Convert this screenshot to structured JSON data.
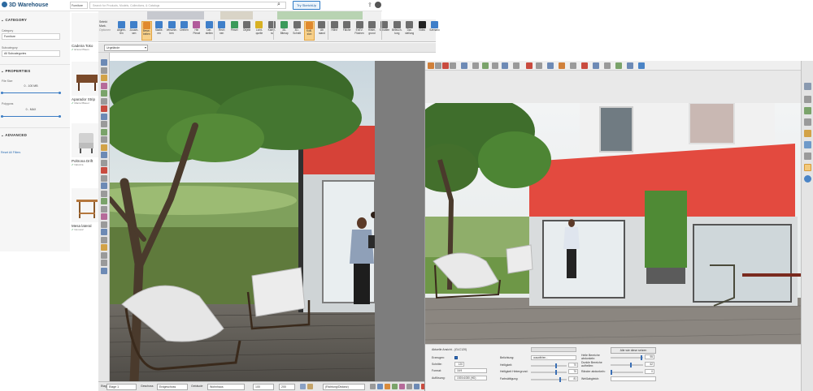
{
  "warehouse": {
    "logo": "3D Warehouse",
    "category_select": "Furniture",
    "search_placeholder": "Search for Products, Models, Collections, & Catalogs",
    "try_button": "Try SketchUp",
    "filter": {
      "category_heading": "CATEGORY",
      "category_label": "Category",
      "category_value": "Furniture",
      "subcategory_label": "Subcategory",
      "subcategory_value": "All Subcategories",
      "properties_heading": "PROPERTIES",
      "file_size_label": "File Size",
      "file_size_range": "0 - 100 MB",
      "file_size_fill": 1.0,
      "polygons_label": "Polygons",
      "polygons_range": "0 - MAX",
      "polygons_fill": 1.0,
      "advanced_heading": "ADVANCED",
      "reset_link": "Reset All Filters"
    },
    "results": [
      {
        "name": "Cadeira Toko",
        "author": "El'ana Pflaum"
      },
      {
        "name": "Aparador Strip",
        "author": "Marcel Bleuel"
      },
      {
        "name": "Poltrona Drift",
        "author": "Natuzza"
      },
      {
        "name": "Mesa lateral",
        "author": "Nomon2"
      }
    ]
  },
  "toolbar": {
    "select_block": [
      "Selekt",
      "Mark.",
      "Optionen"
    ],
    "buttons": [
      {
        "label": "Abgren-\nfen",
        "active": false,
        "color": "#3f7fc9"
      },
      {
        "label": "Zusam-\nsen",
        "active": false,
        "color": "#3f7fc9"
      },
      {
        "label": "Bewe-\nbeiten",
        "active": true,
        "color": "#e0892e"
      },
      {
        "label": "Skalie-\nren",
        "active": false,
        "color": "#3f7fc9"
      },
      {
        "label": "Verschie-\nben",
        "active": false,
        "color": "#3f7fc9"
      },
      {
        "label": "Drehen",
        "active": false,
        "color": "#3f7fc9"
      },
      {
        "label": "Hin\nPinsel",
        "active": false,
        "color": "#b15a9b"
      },
      {
        "label": "Dar-\nstellen",
        "active": false,
        "color": "#3f7fc9"
      },
      {
        "label": "Rech\nnen",
        "active": false,
        "color": "#3f7fc9"
      },
      {
        "label": "Pinsel",
        "active": false,
        "color": "#3b9a5a"
      },
      {
        "label": "Objekt",
        "active": false,
        "color": "#6d6d6d"
      },
      {
        "label": "Licht-\nquelle",
        "active": false,
        "color": "#d8b123"
      },
      {
        "label": "Kame-\nra",
        "active": false,
        "color": "#6d6d6d"
      },
      {
        "label": "3D-\nBitmap",
        "active": false,
        "color": "#3b9a5a"
      },
      {
        "label": "3D-\nSchnitt",
        "active": false,
        "color": "#6d6d6d"
      },
      {
        "label": "Kolli-\nsion",
        "active": true,
        "color": "#e0892e"
      },
      {
        "label": "Ab\nstand",
        "active": false,
        "color": "#6d6d6d"
      },
      {
        "label": "Höhe",
        "active": false,
        "color": "#6d6d6d"
      },
      {
        "label": "Fläche",
        "active": false,
        "color": "#6d6d6d"
      },
      {
        "label": "EnEV-\nFlächen",
        "active": false,
        "color": "#6d6d6d"
      },
      {
        "label": "Hinter-\ngrund",
        "active": false,
        "color": "#6d6d6d"
      },
      {
        "label": "Schatten",
        "active": false,
        "color": "#6d6d6d"
      },
      {
        "label": "Beleuch-\ntung",
        "active": false,
        "color": "#6d6d6d"
      },
      {
        "label": "Dar-\nstellung",
        "active": false,
        "color": "#6d6d6d"
      },
      {
        "label": "Video",
        "active": false,
        "color": "#222222"
      },
      {
        "label": "Szenario",
        "active": false,
        "color": "#3f7fc9"
      }
    ]
  },
  "viewbar": {
    "view_select": "Urgelände"
  },
  "statusbar": {
    "etage_label": "Etage",
    "etage_value": "Etage 1",
    "geschoss_label": "Geschoss",
    "geschoss_value": "Erdgeschoss",
    "gebaeude_label": "Gebäude",
    "gebaeude_value": "Wohnhaus",
    "x_value": "100",
    "y_value": "200",
    "direction_value": "(Richtung/Distanz)"
  },
  "render_panel": {
    "view_label": "Aktuelle Ansicht - (GLC120)",
    "erzeugen_label": "Erzeugen:",
    "schritte_label": "Schritte:",
    "schritte_value": "120",
    "format_label": "Format:",
    "format_value": "16:9",
    "aufloesung_label": "Auflösung:",
    "aufloesung_value": "1920x1080 (HD)",
    "belichtung_label": "Belichtung:",
    "belichtung_value": "auswählen...",
    "helligkeit_label": "Helligkeit:",
    "helligkeit_value": "70",
    "helligkeit_fill": 0.7,
    "hintergrund_label": "Helligkeit Hintergrund:",
    "hintergrund_value": "70",
    "hintergrund_fill": 0.7,
    "farbsaettigung_label": "Farbsättigung:",
    "farbsaettigung_value": "81",
    "farbsaettigung_fill": 0.81,
    "alle_button": "Alle wie diese setzen",
    "helle_label": "Helle Bereiche\nabdunkeln:",
    "helle_value": "95",
    "helle_fill": 0.95,
    "dunkle_label": "Dunkle Bereiche\naufhellen:",
    "dunkle_value": "62",
    "dunkle_fill": 0.62,
    "raender_label": "Ränder abdunkeln:",
    "raender_value": "0",
    "raender_fill": 0.0,
    "weissabgleich_label": "Weißabgleich:"
  },
  "colors": {
    "accent": "#3f7fc9",
    "active_tool": "#f7d08a",
    "facade_red": "#e34a3f"
  }
}
